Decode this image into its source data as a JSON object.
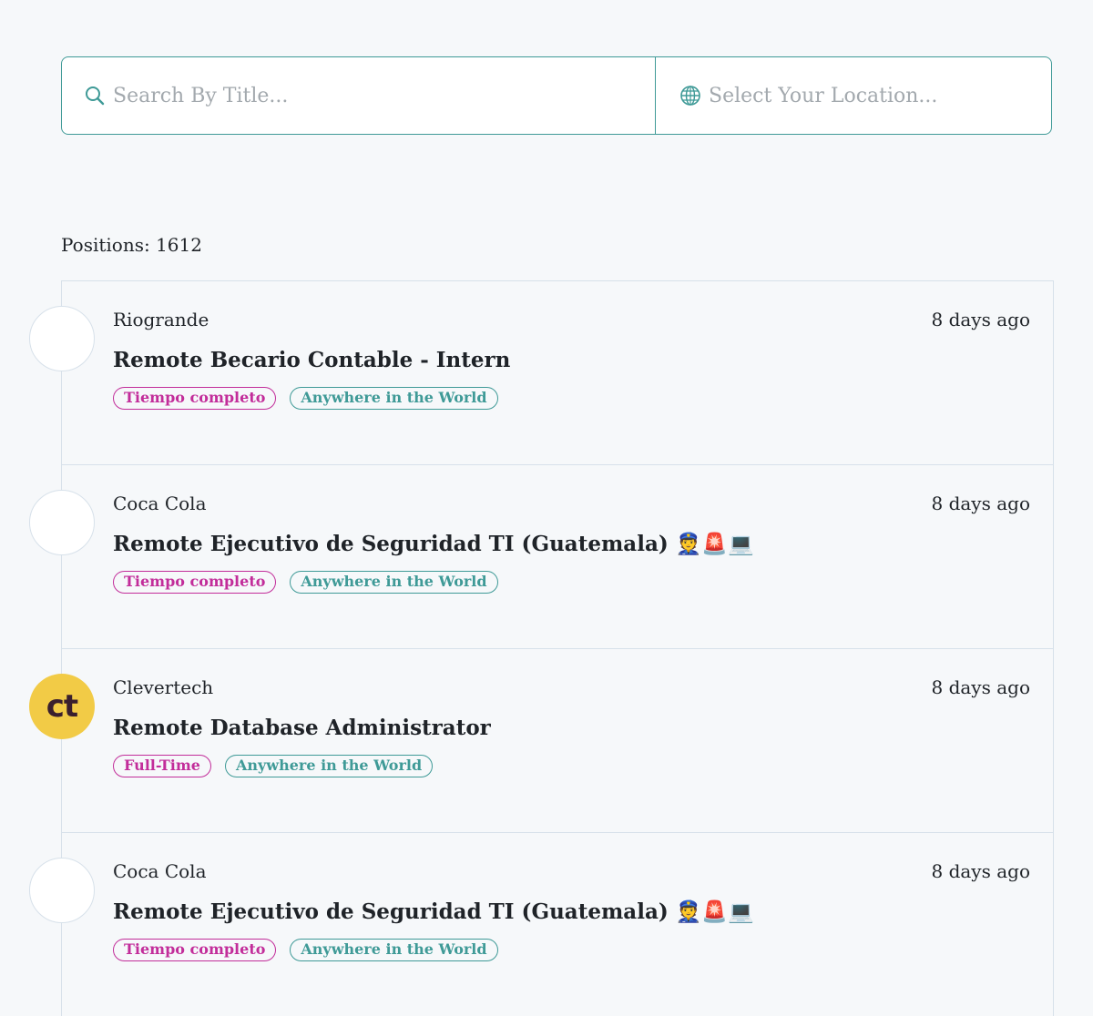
{
  "search": {
    "title_placeholder": "Search By Title...",
    "location_placeholder": "Select Your Location...",
    "title_icon": "search-icon",
    "location_icon": "globe-icon"
  },
  "positions": {
    "text": "Positions: 1612"
  },
  "jobs": [
    {
      "company": "Riogrande",
      "posted": "8 days ago",
      "title": "Remote Becario Contable - Intern",
      "type_tag": "Tiempo completo",
      "location_tag": "Anywhere in the World",
      "logo": ""
    },
    {
      "company": "Coca Cola",
      "posted": "8 days ago",
      "title": "Remote Ejecutivo de Seguridad TI (Guatemala) 👮🚨💻",
      "type_tag": "Tiempo completo",
      "location_tag": "Anywhere in the World",
      "logo": ""
    },
    {
      "company": "Clevertech",
      "posted": "8 days ago",
      "title": "Remote Database Administrator",
      "type_tag": "Full-Time",
      "location_tag": "Anywhere in the World",
      "logo": "ct"
    },
    {
      "company": "Coca Cola",
      "posted": "8 days ago",
      "title": "Remote Ejecutivo de Seguridad TI (Guatemala) 👮🚨💻",
      "type_tag": "Tiempo completo",
      "location_tag": "Anywhere in the World",
      "logo": ""
    }
  ],
  "colors": {
    "accent": "#3f9a97",
    "type_tag": "#c22d9a",
    "logo_bg": "#f2cb46"
  }
}
